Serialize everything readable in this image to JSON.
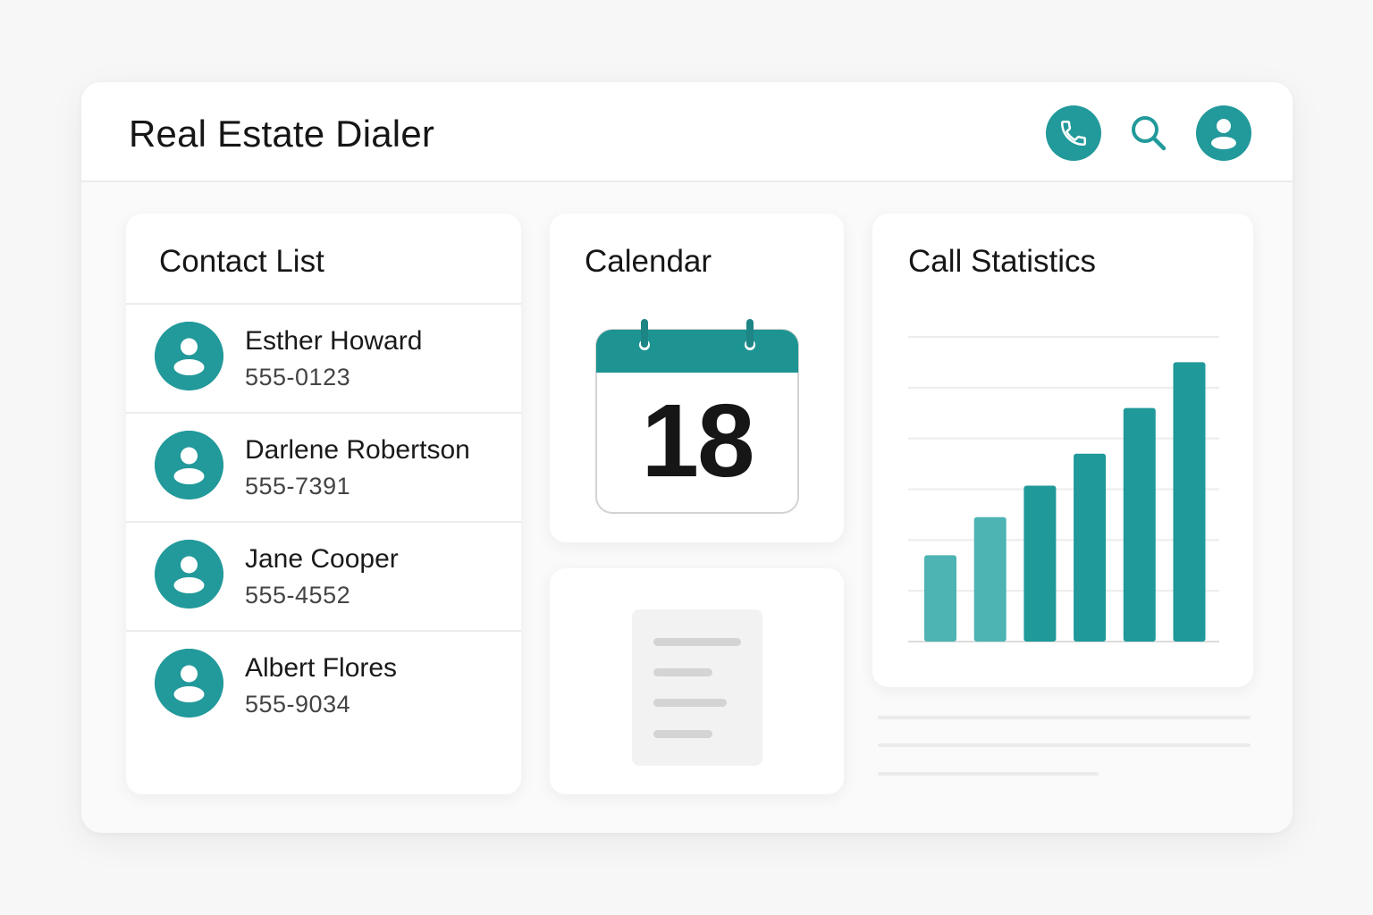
{
  "app": {
    "title": "Real Estate Dialer",
    "accent_color": "#22999a",
    "header_icons": [
      "phone-icon",
      "search-icon",
      "user-icon"
    ]
  },
  "contacts": {
    "title": "Contact List",
    "items": [
      {
        "name": "Esther Howard",
        "phone": "555-0123"
      },
      {
        "name": "Darlene Robertson",
        "phone": "555-7391"
      },
      {
        "name": "Jane Cooper",
        "phone": "555-4552"
      },
      {
        "name": "Albert Flores",
        "phone": "555-9034"
      }
    ]
  },
  "calendar": {
    "title": "Calendar",
    "day": "18"
  },
  "notes": {
    "icon": "document-icon"
  },
  "stats": {
    "title": "Call Statistics",
    "bar_values": [
      1.7,
      2.45,
      3.07,
      3.7,
      4.6,
      5.5
    ],
    "y_max": 6,
    "gridlines": 6,
    "bar_colors": [
      "#4db3b3",
      "#4db3b3",
      "#1f9999",
      "#1f9999",
      "#1f9999",
      "#1f9999"
    ]
  }
}
